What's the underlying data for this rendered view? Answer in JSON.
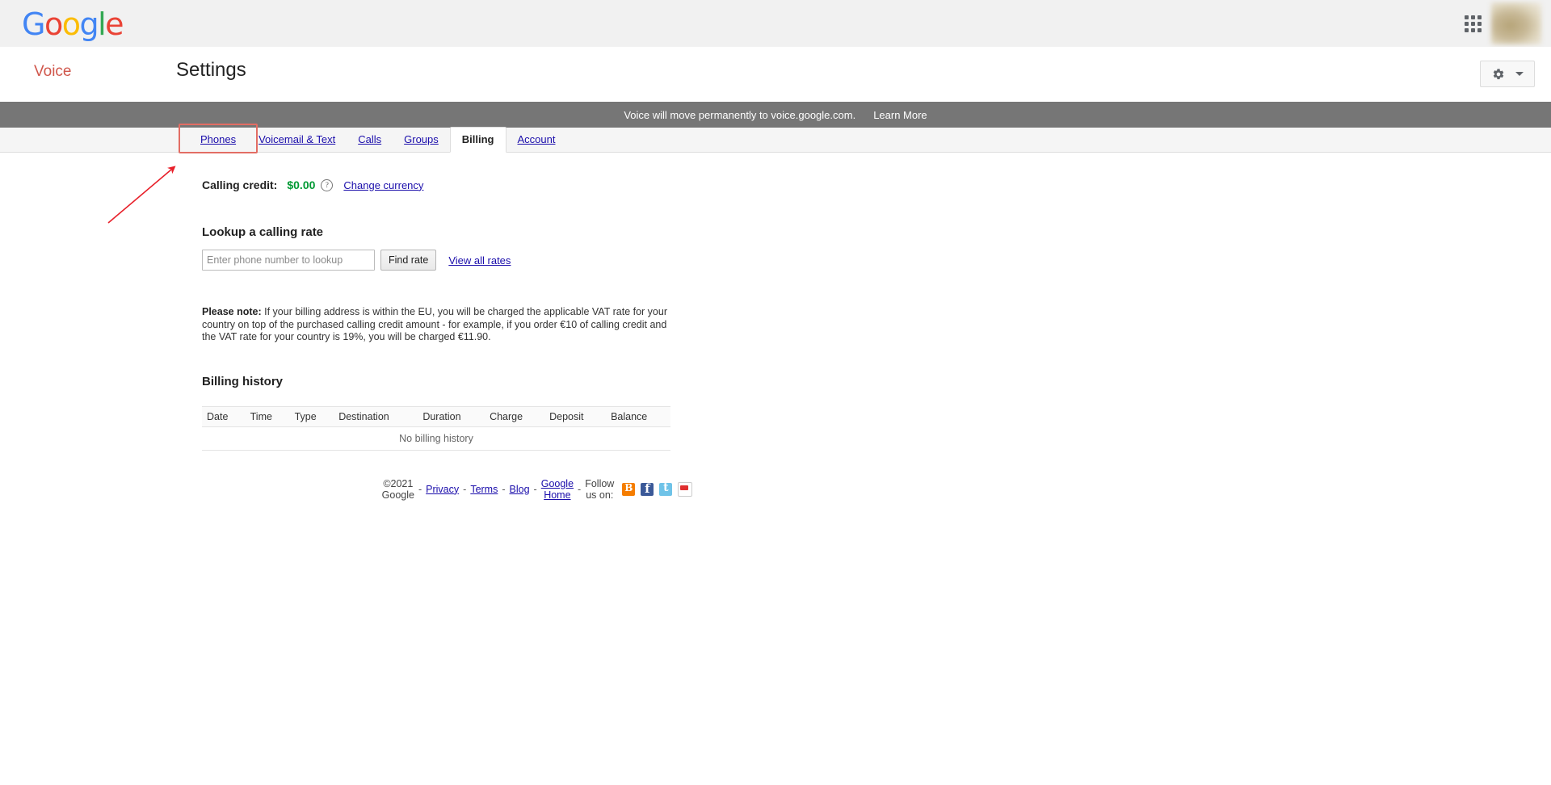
{
  "gbar": {
    "logo_letters": [
      {
        "char": "G",
        "color": "#4285F4"
      },
      {
        "char": "o",
        "color": "#EA4335"
      },
      {
        "char": "o",
        "color": "#FBBC05"
      },
      {
        "char": "g",
        "color": "#4285F4"
      },
      {
        "char": "l",
        "color": "#34A853"
      },
      {
        "char": "e",
        "color": "#EA4335"
      }
    ],
    "apps_icon": "apps-grid-icon",
    "avatar": "account-avatar"
  },
  "header": {
    "brand": "Voice",
    "title": "Settings",
    "settings_icon": "gear-icon",
    "dropdown_icon": "chevron-down-icon"
  },
  "notice": {
    "message": "Voice will move permanently to voice.google.com.",
    "link_label": "Learn More"
  },
  "tabs": [
    {
      "label": "Phones",
      "selected": false,
      "highlighted": true
    },
    {
      "label": "Voicemail & Text",
      "selected": false,
      "highlighted": false
    },
    {
      "label": "Calls",
      "selected": false,
      "highlighted": false
    },
    {
      "label": "Groups",
      "selected": false,
      "highlighted": false
    },
    {
      "label": "Billing",
      "selected": true,
      "highlighted": false
    },
    {
      "label": "Account",
      "selected": false,
      "highlighted": false
    }
  ],
  "billing": {
    "credit_label": "Calling credit:",
    "credit_amount": "$0.00",
    "credit_color": "#009933",
    "help_glyph": "?",
    "change_currency_label": "Change currency",
    "lookup": {
      "title": "Lookup a calling rate",
      "input_value": "",
      "input_placeholder": "Enter phone number to lookup",
      "find_button": "Find rate",
      "view_all_label": "View all rates"
    },
    "note": {
      "prefix": "Please note:",
      "body": "If your billing address is within the EU, you will be charged the applicable VAT rate for your country on top of the purchased calling credit amount - for example, if you order €10 of calling credit and the VAT rate for your country is 19%, you will be charged €11.90."
    },
    "history": {
      "title": "Billing history",
      "columns": [
        "Date",
        "Time",
        "Type",
        "Destination",
        "Duration",
        "Charge",
        "Deposit",
        "Balance"
      ],
      "rows": [],
      "empty_message": "No billing history"
    }
  },
  "footer": {
    "copyright": "©2021 Google",
    "links": [
      "Privacy",
      "Terms",
      "Blog",
      "Google Home"
    ],
    "follow_label": "Follow us on:",
    "separator": "-",
    "social": [
      {
        "name": "blogger-icon",
        "color": "#f57d00"
      },
      {
        "name": "facebook-icon",
        "color": "#3b5998"
      },
      {
        "name": "twitter-icon",
        "color": "#6fc3e8"
      },
      {
        "name": "youtube-icon",
        "color": "#e02f2f"
      }
    ]
  },
  "annotation": {
    "arrow_color": "#e8202a",
    "highlight_color": "#e26d64"
  }
}
